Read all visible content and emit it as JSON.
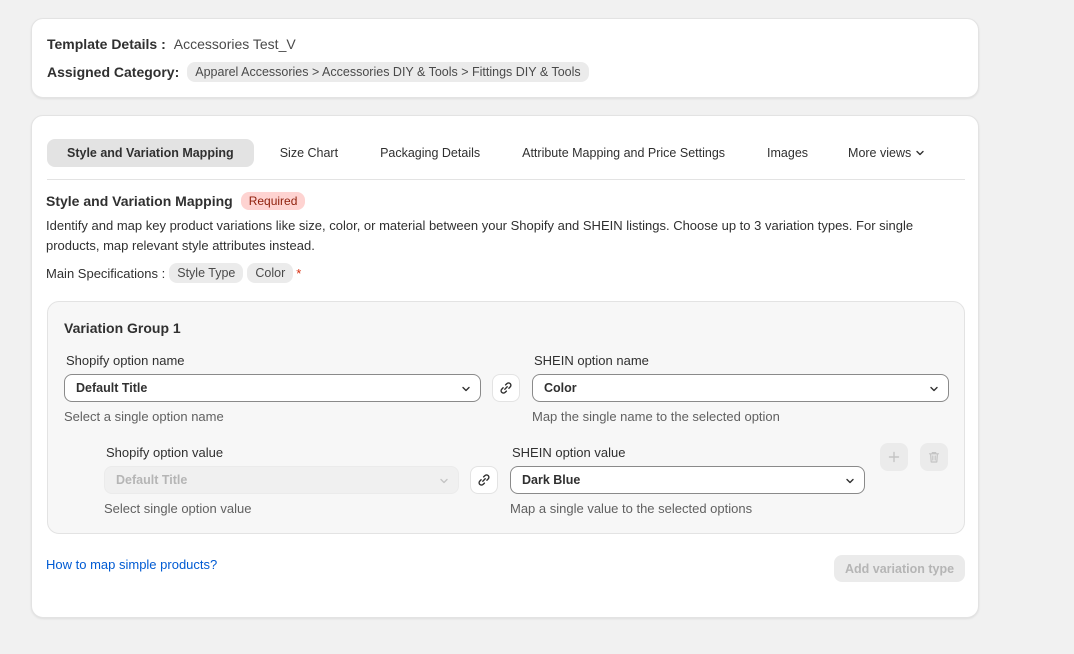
{
  "template": {
    "details_label": "Template Details :",
    "details_value": "Accessories Test_V",
    "category_label": "Assigned Category:",
    "category_value": "Apparel Accessories > Accessories DIY & Tools > Fittings DIY & Tools"
  },
  "tabs": [
    {
      "label": "Style and Variation Mapping",
      "active": true
    },
    {
      "label": "Size Chart",
      "active": false
    },
    {
      "label": "Packaging Details",
      "active": false
    },
    {
      "label": "Attribute Mapping and Price Settings",
      "active": false
    },
    {
      "label": "Images",
      "active": false
    },
    {
      "label": "More views",
      "active": false
    }
  ],
  "section": {
    "title": "Style and Variation Mapping",
    "badge": "Required",
    "description": "Identify and map key product variations like size, color, or material between your Shopify and SHEIN listings. Choose up to 3 variation types. For single products, map relevant style attributes instead.",
    "main_specs_label": "Main Specifications :",
    "main_specs": [
      "Style Type",
      "Color"
    ],
    "required_marker": "*"
  },
  "variation_group": {
    "title": "Variation Group 1",
    "shopify_option_name_label": "Shopify option name",
    "shopify_option_name_value": "Default Title",
    "shopify_option_name_help": "Select a single option name",
    "shein_option_name_label": "SHEIN option name",
    "shein_option_name_value": "Color",
    "shein_option_name_help": "Map the single name to the selected option",
    "shopify_option_value_label": "Shopify option value",
    "shopify_option_value_value": "Default Title",
    "shopify_option_value_help": "Select single option value",
    "shein_option_value_label": "SHEIN option value",
    "shein_option_value_value": "Dark Blue",
    "shein_option_value_help": "Map a single value to the selected options"
  },
  "footer": {
    "help_link": "How to map simple products?",
    "add_variation_button": "Add variation type"
  },
  "icons": {
    "link": "link-icon",
    "chevron": "chevron-down-icon",
    "plus": "plus-icon",
    "delete": "trash-icon"
  },
  "colors": {
    "link": "#005bd3",
    "required_badge_bg": "#fed3d1",
    "required_badge_text": "#8e1f0b",
    "asterisk": "#d72c0d"
  }
}
